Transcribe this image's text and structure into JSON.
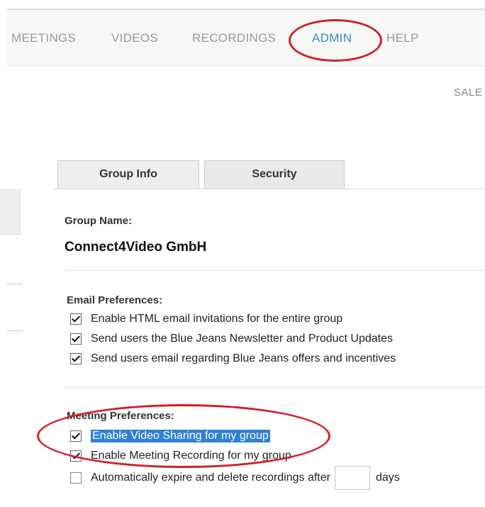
{
  "nav": {
    "items": [
      {
        "label": "MEETINGS"
      },
      {
        "label": "VIDEOS"
      },
      {
        "label": "RECORDINGS"
      },
      {
        "label": "ADMIN"
      },
      {
        "label": "HELP"
      }
    ],
    "active": "ADMIN"
  },
  "header": {
    "sales_text": "SALE"
  },
  "tabs": [
    {
      "label": "Group Info"
    },
    {
      "label": "Security"
    }
  ],
  "group": {
    "name_label": "Group Name:",
    "name_value": "Connect4Video GmbH"
  },
  "email_prefs": {
    "heading": "Email Preferences:",
    "items": [
      {
        "label": "Enable HTML email invitations for the entire group",
        "checked": true
      },
      {
        "label": "Send users the Blue Jeans Newsletter and Product Updates",
        "checked": true
      },
      {
        "label": "Send users email regarding Blue Jeans offers and incentives",
        "checked": true
      }
    ]
  },
  "meeting_prefs": {
    "heading": "Meeting Preferences:",
    "items": [
      {
        "label": "Enable Video Sharing for my group",
        "checked": true
      },
      {
        "label": "Enable Meeting Recording for my group",
        "checked": true
      }
    ],
    "expire": {
      "label": "Automatically expire and delete recordings after",
      "value": "",
      "unit": "days",
      "checked": false
    }
  },
  "colors": {
    "annotation_red": "#d0202a",
    "active_nav": "#3b8db5",
    "selection_blue": "#2f80d6"
  }
}
